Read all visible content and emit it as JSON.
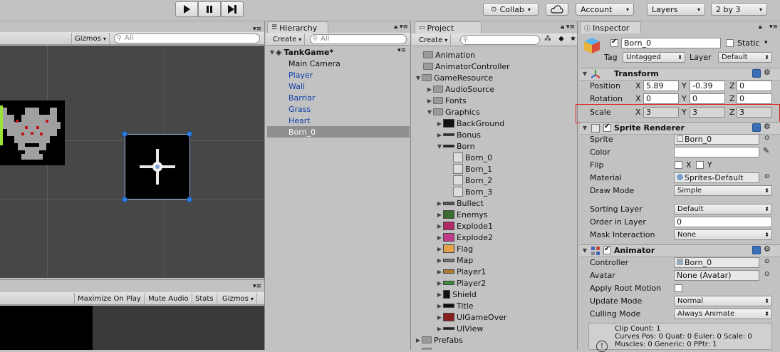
{
  "toolbar": {
    "collab": "Collab",
    "account": "Account",
    "layers": "Layers",
    "layout": "2 by 3"
  },
  "scene": {
    "gizmos": "Gizmos",
    "search_placeholder": "All"
  },
  "game": {
    "maximize": "Maximize On Play",
    "mute": "Mute Audio",
    "stats": "Stats",
    "gizmos": "Gizmos"
  },
  "hierarchy": {
    "tab": "Hierarchy",
    "create": "Create",
    "search_placeholder": "All",
    "scene_name": "TankGame*",
    "items": [
      {
        "label": "Main Camera"
      },
      {
        "label": "Player"
      },
      {
        "label": "Wall"
      },
      {
        "label": "Barriar"
      },
      {
        "label": "Grass"
      },
      {
        "label": "Heart"
      },
      {
        "label": "Born_0"
      }
    ]
  },
  "project": {
    "tab": "Project",
    "create": "Create",
    "tree": [
      {
        "label": "Animation"
      },
      {
        "label": "AnimatorController"
      },
      {
        "label": "GameResource"
      },
      {
        "label": "AudioSource"
      },
      {
        "label": "Fonts"
      },
      {
        "label": "Graphics"
      },
      {
        "label": "BackGround"
      },
      {
        "label": "Bonus"
      },
      {
        "label": "Born"
      },
      {
        "label": "Born_0"
      },
      {
        "label": "Born_1"
      },
      {
        "label": "Born_2"
      },
      {
        "label": "Born_3"
      },
      {
        "label": "Bullect"
      },
      {
        "label": "Enemys"
      },
      {
        "label": "Explode1"
      },
      {
        "label": "Explode2"
      },
      {
        "label": "Flag"
      },
      {
        "label": "Map"
      },
      {
        "label": "Player1"
      },
      {
        "label": "Player2"
      },
      {
        "label": "Shield"
      },
      {
        "label": "Title"
      },
      {
        "label": "UIGameOver"
      },
      {
        "label": "UIView"
      },
      {
        "label": "Prefabs"
      }
    ]
  },
  "inspector": {
    "tab": "Inspector",
    "object_name": "Born_0",
    "static": "Static",
    "tag_label": "Tag",
    "tag_value": "Untagged",
    "layer_label": "Layer",
    "layer_value": "Default",
    "transform": {
      "title": "Transform",
      "position_label": "Position",
      "rotation_label": "Rotation",
      "scale_label": "Scale",
      "x": "X",
      "y": "Y",
      "z": "Z",
      "position": [
        "5.89",
        "-0.39",
        "0"
      ],
      "rotation": [
        "0",
        "0",
        "0"
      ],
      "scale": [
        "3",
        "3",
        "3"
      ]
    },
    "sprite_renderer": {
      "title": "Sprite Renderer",
      "sprite_label": "Sprite",
      "sprite_value": "Born_0",
      "color_label": "Color",
      "flip_label": "Flip",
      "flip_x": "X",
      "flip_y": "Y",
      "material_label": "Material",
      "material_value": "Sprites-Default",
      "draw_mode_label": "Draw Mode",
      "draw_mode_value": "Simple",
      "sorting_layer_label": "Sorting Layer",
      "sorting_layer_value": "Default",
      "order_label": "Order in Layer",
      "order_value": "0",
      "mask_label": "Mask Interaction",
      "mask_value": "None"
    },
    "animator": {
      "title": "Animator",
      "controller_label": "Controller",
      "controller_value": "Born_0",
      "avatar_label": "Avatar",
      "avatar_value": "None (Avatar)",
      "root_motion_label": "Apply Root Motion",
      "update_mode_label": "Update Mode",
      "update_mode_value": "Normal",
      "culling_label": "Culling Mode",
      "culling_value": "Always Animate",
      "info_line1": "Clip Count: 1",
      "info_line2": "Curves Pos: 0 Quat: 0 Euler: 0 Scale: 0",
      "info_line3": "Muscles: 0 Generic: 0 PPtr: 1"
    }
  },
  "colors": {
    "highlight": "#e02020",
    "selected_row": "#8f8f8f",
    "scene_bg": "#474747"
  }
}
